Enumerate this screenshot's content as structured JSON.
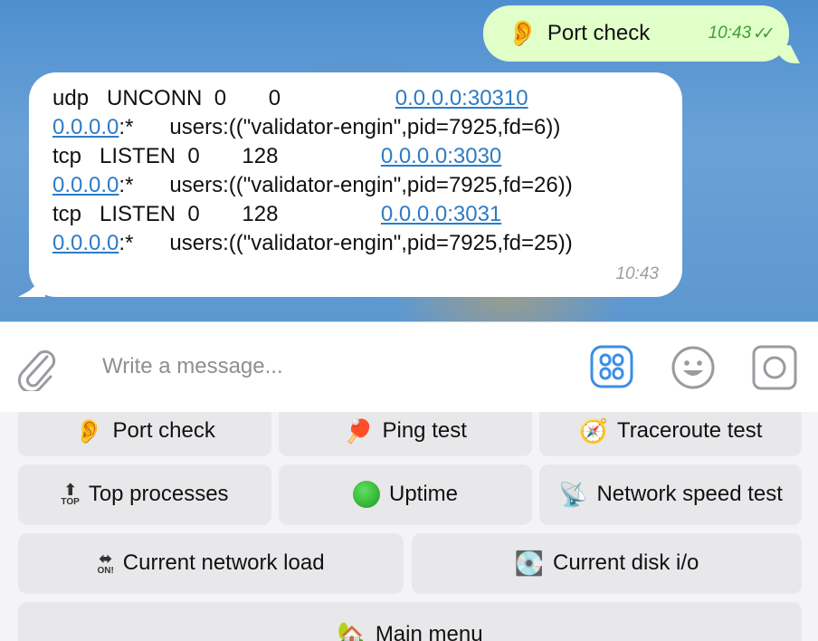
{
  "outgoing": {
    "icon": "👂",
    "icon_name": "ear-icon",
    "text": "Port check",
    "time": "10:43",
    "ticks": "✓✓"
  },
  "incoming": {
    "lines": [
      {
        "pre": "udp   UNCONN  0       0                   ",
        "link": "0.0.0.0:30310",
        "post": ""
      },
      {
        "pre": "",
        "link": "0.0.0.0",
        "post": ":*      users:((\"validator-engin\",pid=7925,fd=6))"
      },
      {
        "pre": "tcp   LISTEN  0       128                 ",
        "link": "0.0.0.0:3030",
        "post": ""
      },
      {
        "pre": "",
        "link": "0.0.0.0",
        "post": ":*      users:((\"validator-engin\",pid=7925,fd=26))"
      },
      {
        "pre": "tcp   LISTEN  0       128                 ",
        "link": "0.0.0.0:3031",
        "post": ""
      },
      {
        "pre": "",
        "link": "0.0.0.0",
        "post": ":*      users:((\"validator-engin\",pid=7925,fd=25))"
      }
    ],
    "time": "10:43"
  },
  "input": {
    "placeholder": "Write a message..."
  },
  "keyboard": {
    "rows": [
      [
        {
          "icon": "👂",
          "icon_name": "ear-icon",
          "label": "Port check"
        },
        {
          "icon": "🏓",
          "icon_name": "ping-pong-icon",
          "label": "Ping test"
        },
        {
          "icon": "🧭",
          "icon_name": "compass-icon",
          "label": "Traceroute test"
        }
      ],
      [
        {
          "icon": "🔝",
          "icon_name": "top-arrow-icon",
          "label": "Top processes"
        },
        {
          "icon": "🟢",
          "icon_name": "green-circle-icon",
          "label": "Uptime"
        },
        {
          "icon": "📡",
          "icon_name": "satellite-dish-icon",
          "label": "Network speed test"
        }
      ],
      [
        {
          "icon": "🔛",
          "icon_name": "on-arrow-icon",
          "label": "Current network load"
        },
        {
          "icon": "💽",
          "icon_name": "disk-icon",
          "label": "Current disk i/o"
        }
      ],
      [
        {
          "icon": "🏡",
          "icon_name": "house-icon",
          "label": "Main menu"
        }
      ]
    ]
  },
  "colors": {
    "outgoing_bubble": "#e1ffc8",
    "link": "#2d7cc6",
    "accent": "#3a8ee6",
    "check": "#3fa03a"
  }
}
